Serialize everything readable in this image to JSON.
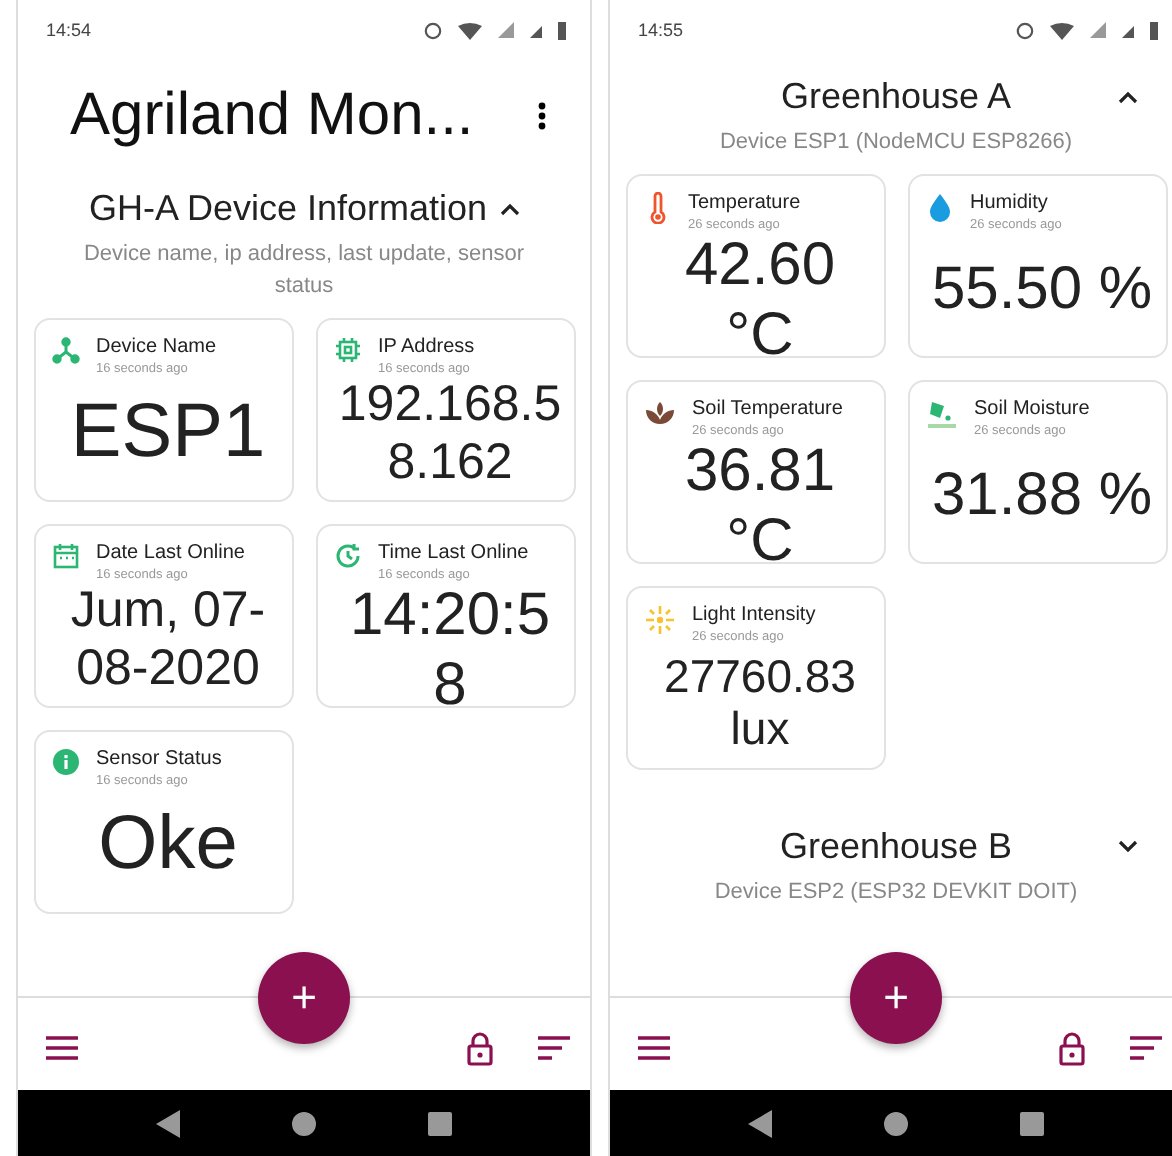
{
  "screens": [
    {
      "status_bar": {
        "time": "14:54"
      },
      "app_bar": {
        "title": "Agriland Mon..."
      },
      "sections": [
        {
          "title": "GH-A Device Information",
          "subtitle": "Device name, ip address, last update, sensor status",
          "expanded": true,
          "cards": [
            {
              "kind": "device",
              "title": "Device Name",
              "updated": "16 seconds ago",
              "value": "ESP1"
            },
            {
              "kind": "chip",
              "title": "IP Address",
              "updated": "16 seconds ago",
              "value": "192.168.58.162"
            },
            {
              "kind": "calendar",
              "title": "Date Last Online",
              "updated": "16 seconds ago",
              "value": "Jum, 07-08-2020"
            },
            {
              "kind": "clock",
              "title": "Time Last Online",
              "updated": "16 seconds ago",
              "value": "14:20:58"
            },
            {
              "kind": "info",
              "title": "Sensor Status",
              "updated": "16 seconds ago",
              "value": "Oke"
            }
          ]
        }
      ],
      "fab": {
        "label": "+"
      }
    },
    {
      "status_bar": {
        "time": "14:55"
      },
      "sections": [
        {
          "title": "Greenhouse A",
          "subtitle": "Device ESP1 (NodeMCU ESP8266)",
          "expanded": true,
          "cards": [
            {
              "kind": "thermometer",
              "title": "Temperature",
              "updated": "26 seconds ago",
              "value": "42.60 °C"
            },
            {
              "kind": "drop",
              "title": "Humidity",
              "updated": "26 seconds ago",
              "value": "55.50 %"
            },
            {
              "kind": "soil",
              "title": "Soil Temperature",
              "updated": "26 seconds ago",
              "value": "36.81 °C"
            },
            {
              "kind": "moisture",
              "title": "Soil Moisture",
              "updated": "26 seconds ago",
              "value": "31.88 %"
            },
            {
              "kind": "sun",
              "title": "Light Intensity",
              "updated": "26 seconds ago",
              "value": "27760.83 lux"
            }
          ]
        },
        {
          "title": "Greenhouse B",
          "subtitle": "Device ESP2 (ESP32 DEVKIT DOIT)",
          "expanded": false
        }
      ],
      "fab": {
        "label": "+"
      }
    }
  ]
}
